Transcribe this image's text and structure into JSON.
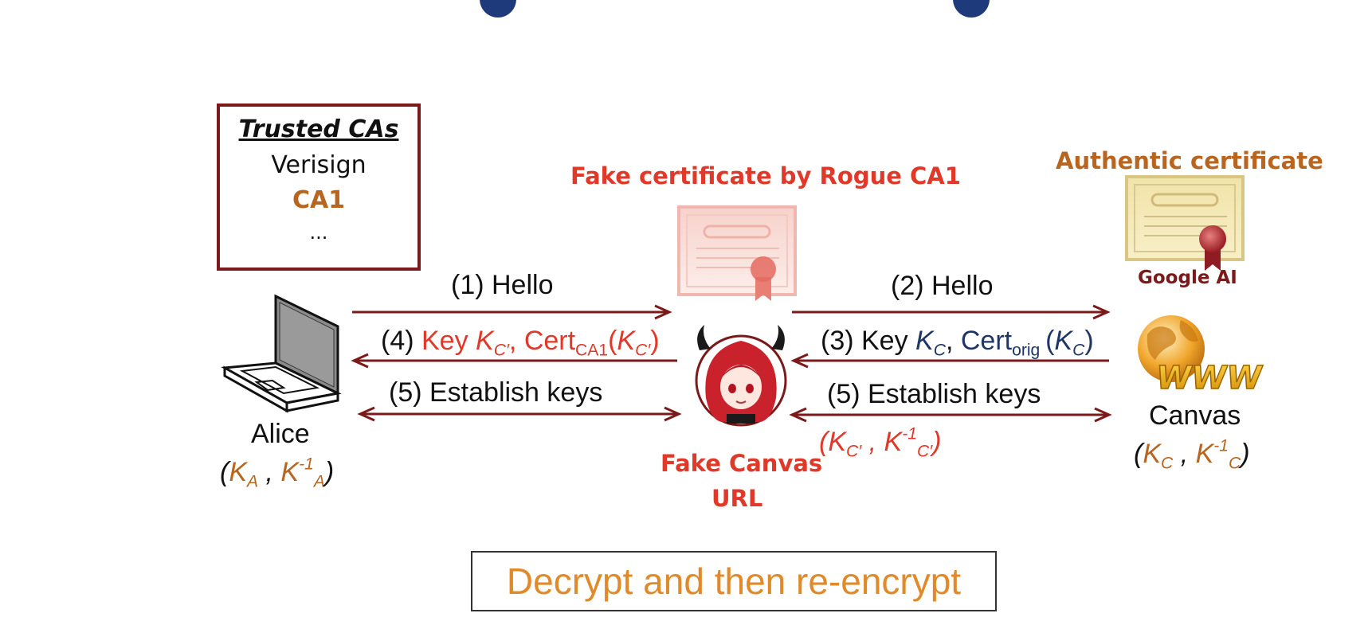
{
  "trusted_cas": {
    "title": "Trusted CAs",
    "items": [
      "Verisign",
      "CA1",
      "..."
    ]
  },
  "labels": {
    "fake_cert": "Fake certificate by Rogue CA1",
    "authentic_cert": "Authentic certificate",
    "google_ai": "Google AI",
    "fake_canvas": "Fake Canvas",
    "url": "URL"
  },
  "alice": {
    "name": "Alice",
    "keys_A": "A"
  },
  "canvas": {
    "name": "Canvas"
  },
  "arrows": {
    "hello1": "(1) Hello",
    "hello2": "(2) Hello",
    "step3_prefix": "(3) Key ",
    "step4_prefix": "(4) ",
    "establish_left": "(5) Establish keys",
    "establish_right": "(5) Establish keys"
  },
  "bottom": {
    "text": "Decrypt and then re-encrypt"
  },
  "colors": {
    "arrow": "#7a1a1a",
    "red": "#e0392a",
    "orange": "#b8651f",
    "navy": "#1f3564",
    "bottom_text": "#e08a2a",
    "title_fragment": "#1f3a7a"
  },
  "icons": [
    "laptop-icon",
    "certificate-icon",
    "devil-avatar-icon",
    "globe-www-icon"
  ]
}
